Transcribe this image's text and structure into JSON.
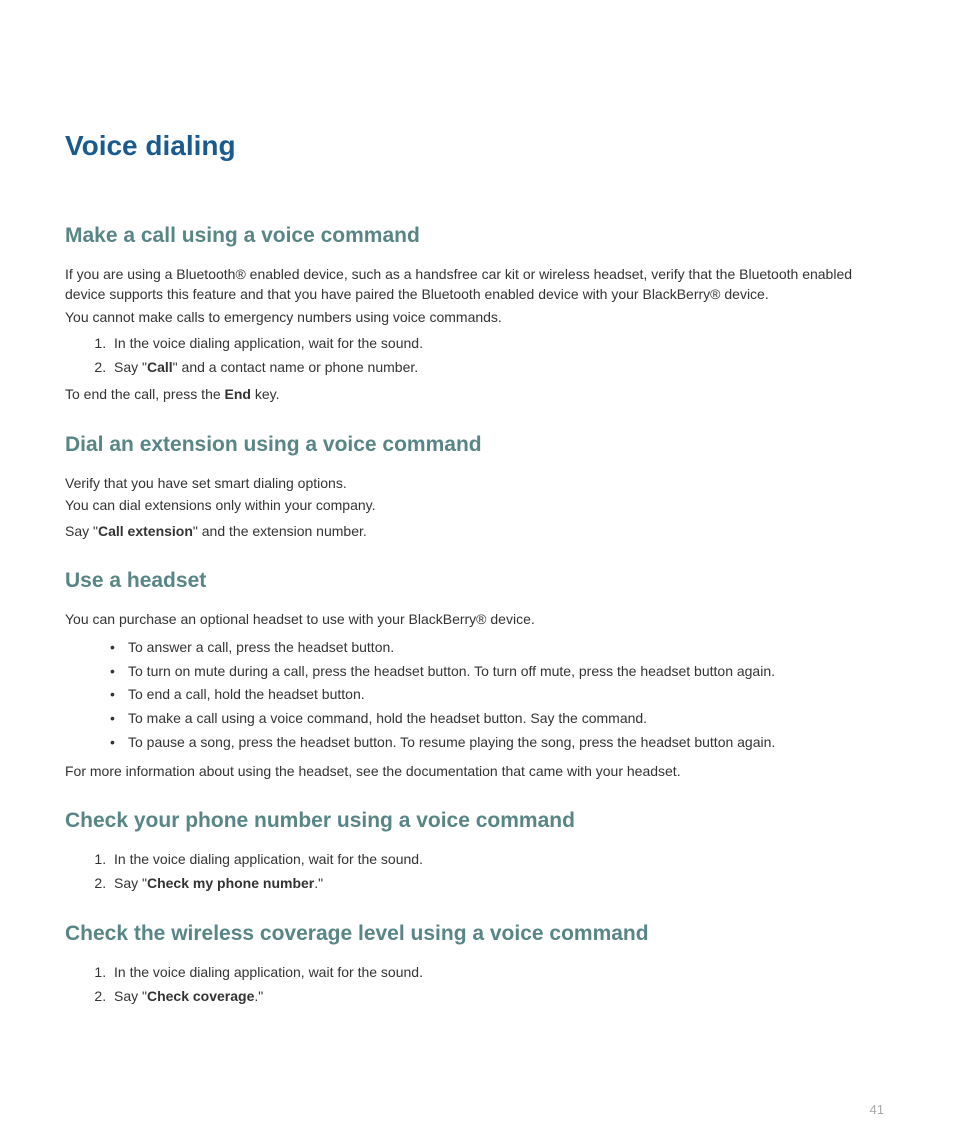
{
  "page_title": "Voice dialing",
  "page_number": "41",
  "sections": {
    "s1": {
      "heading": "Make a call using a voice command",
      "para1": "If you are using a Bluetooth® enabled device, such as a handsfree car kit or wireless headset, verify that the Bluetooth enabled device supports this feature and that you have paired the Bluetooth enabled device with your BlackBerry® device.",
      "para2": "You cannot make calls to emergency numbers using voice commands.",
      "step1": "In the voice dialing application, wait for the sound.",
      "step2_prefix": "Say \"",
      "step2_bold": "Call",
      "step2_suffix": "\" and a contact name or phone number.",
      "after_prefix": "To end the call, press the ",
      "after_bold": "End",
      "after_suffix": " key."
    },
    "s2": {
      "heading": "Dial an extension using a voice command",
      "para1": "Verify that you have set smart dialing options.",
      "para2": "You can dial extensions only within your company.",
      "para3_prefix": "Say \"",
      "para3_bold": "Call extension",
      "para3_suffix": "\" and the extension number."
    },
    "s3": {
      "heading": "Use a headset",
      "intro": "You can purchase an optional headset to use with your BlackBerry® device.",
      "b1": "To answer a call, press the headset button.",
      "b2": "To turn on mute during a call, press the headset button. To turn off mute, press the headset button again.",
      "b3": "To end a call, hold the headset button.",
      "b4": "To make a call using a voice command, hold the headset button. Say the command.",
      "b5": "To pause a song, press the headset button. To resume playing the song, press the headset button again.",
      "after": "For more information about using the headset, see the documentation that came with your headset."
    },
    "s4": {
      "heading": "Check your phone number using a voice command",
      "step1": "In the voice dialing application, wait for the sound.",
      "step2_prefix": "Say \"",
      "step2_bold": "Check my phone number",
      "step2_suffix": ".\""
    },
    "s5": {
      "heading": "Check the wireless coverage level using a voice command",
      "step1": "In the voice dialing application, wait for the sound.",
      "step2_prefix": "Say \"",
      "step2_bold": "Check coverage",
      "step2_suffix": ".\""
    }
  }
}
